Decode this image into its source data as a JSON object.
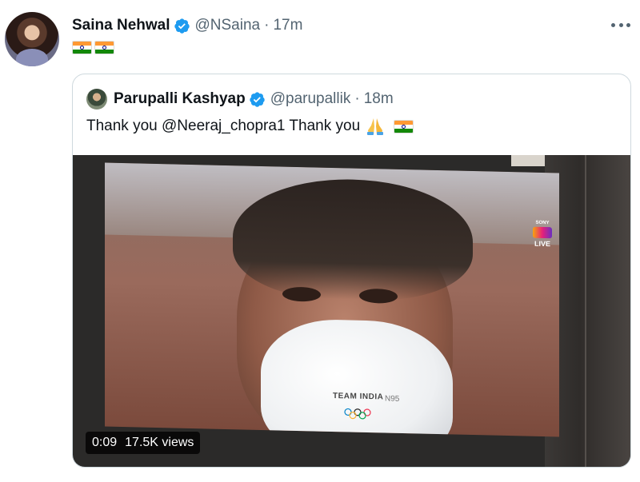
{
  "tweet": {
    "author_name": "Saina Nehwal",
    "author_handle": "@NSaina",
    "separator": "·",
    "time": "17m",
    "text_flags": [
      "india-flag",
      "india-flag"
    ]
  },
  "quoted": {
    "author_name": "Parupalli Kashyap",
    "author_handle": "@parupallik",
    "separator": "·",
    "time": "18m",
    "text": "Thank you @Neeraj_chopra1 Thank you",
    "emojis": [
      "folded-hands",
      "india-flag"
    ]
  },
  "media": {
    "time": "0:09",
    "views": "17.5K views",
    "broadcast_badge_brand": "SONY",
    "broadcast_badge_label": "LIVE",
    "mask_label": "TEAM INDIA",
    "mask_rating": "N95"
  },
  "colors": {
    "text_primary": "#0f1419",
    "text_secondary": "#536471",
    "verified_blue": "#1d9bf0",
    "border": "#cfd9de"
  }
}
